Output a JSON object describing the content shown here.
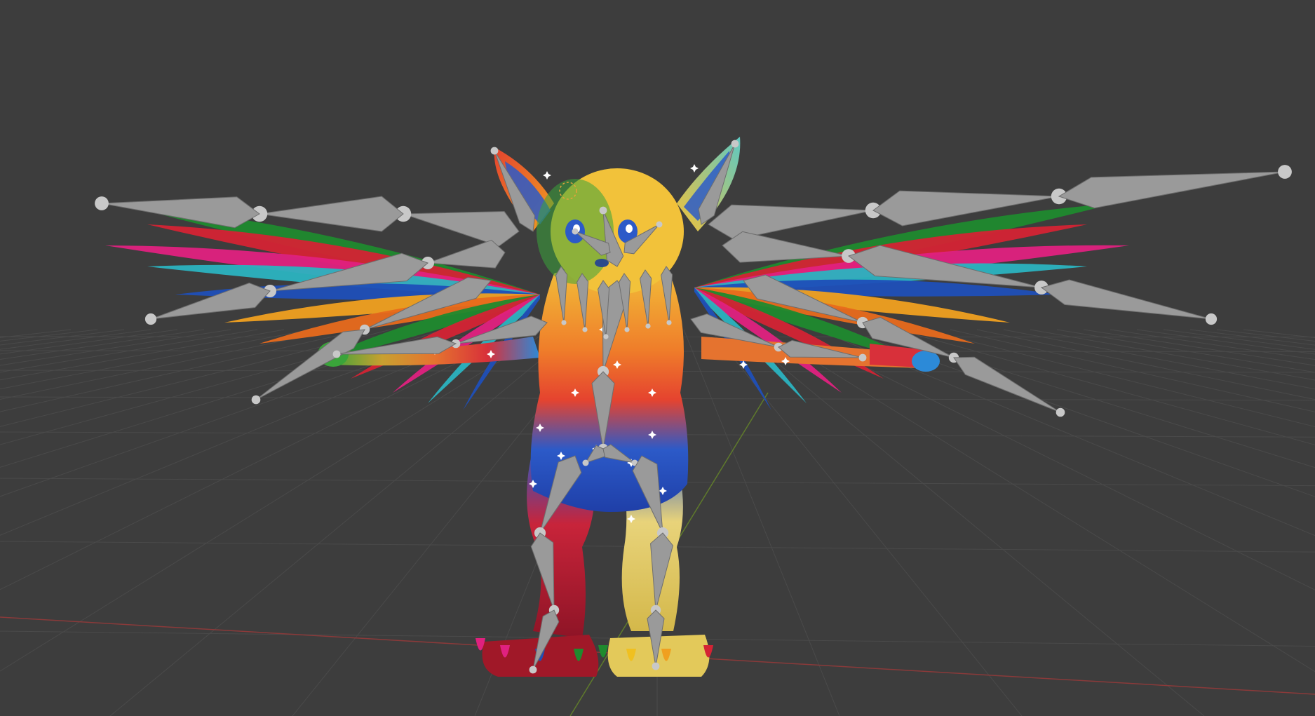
{
  "viewport": {
    "background": "#3d3d3d",
    "grid_color": "#4a4a4a",
    "x_axis_color": "#8a3a3a",
    "y_axis_color": "#5f7a2c",
    "bone_color": "#9a9a9a",
    "bone_joint_color": "#c8c8c8",
    "object_origin_color": "#e6a23c"
  },
  "model": {
    "icon": "winged-creature-rigged-mesh",
    "feather_colors": [
      "#1f8a2e",
      "#d42334",
      "#e0217f",
      "#2bb3c0",
      "#1f4fb8",
      "#f0a020",
      "#e86a1c"
    ],
    "body_colors": {
      "head": "#f2c23a",
      "ear_left": "#e5432f",
      "ear_right": "#5ec8c2",
      "chest": "#e5432f",
      "belly": "#2c5ac8",
      "leg_left": "#b0182b",
      "leg_right": "#e3c95a",
      "star_pattern": "#ffffff"
    }
  }
}
